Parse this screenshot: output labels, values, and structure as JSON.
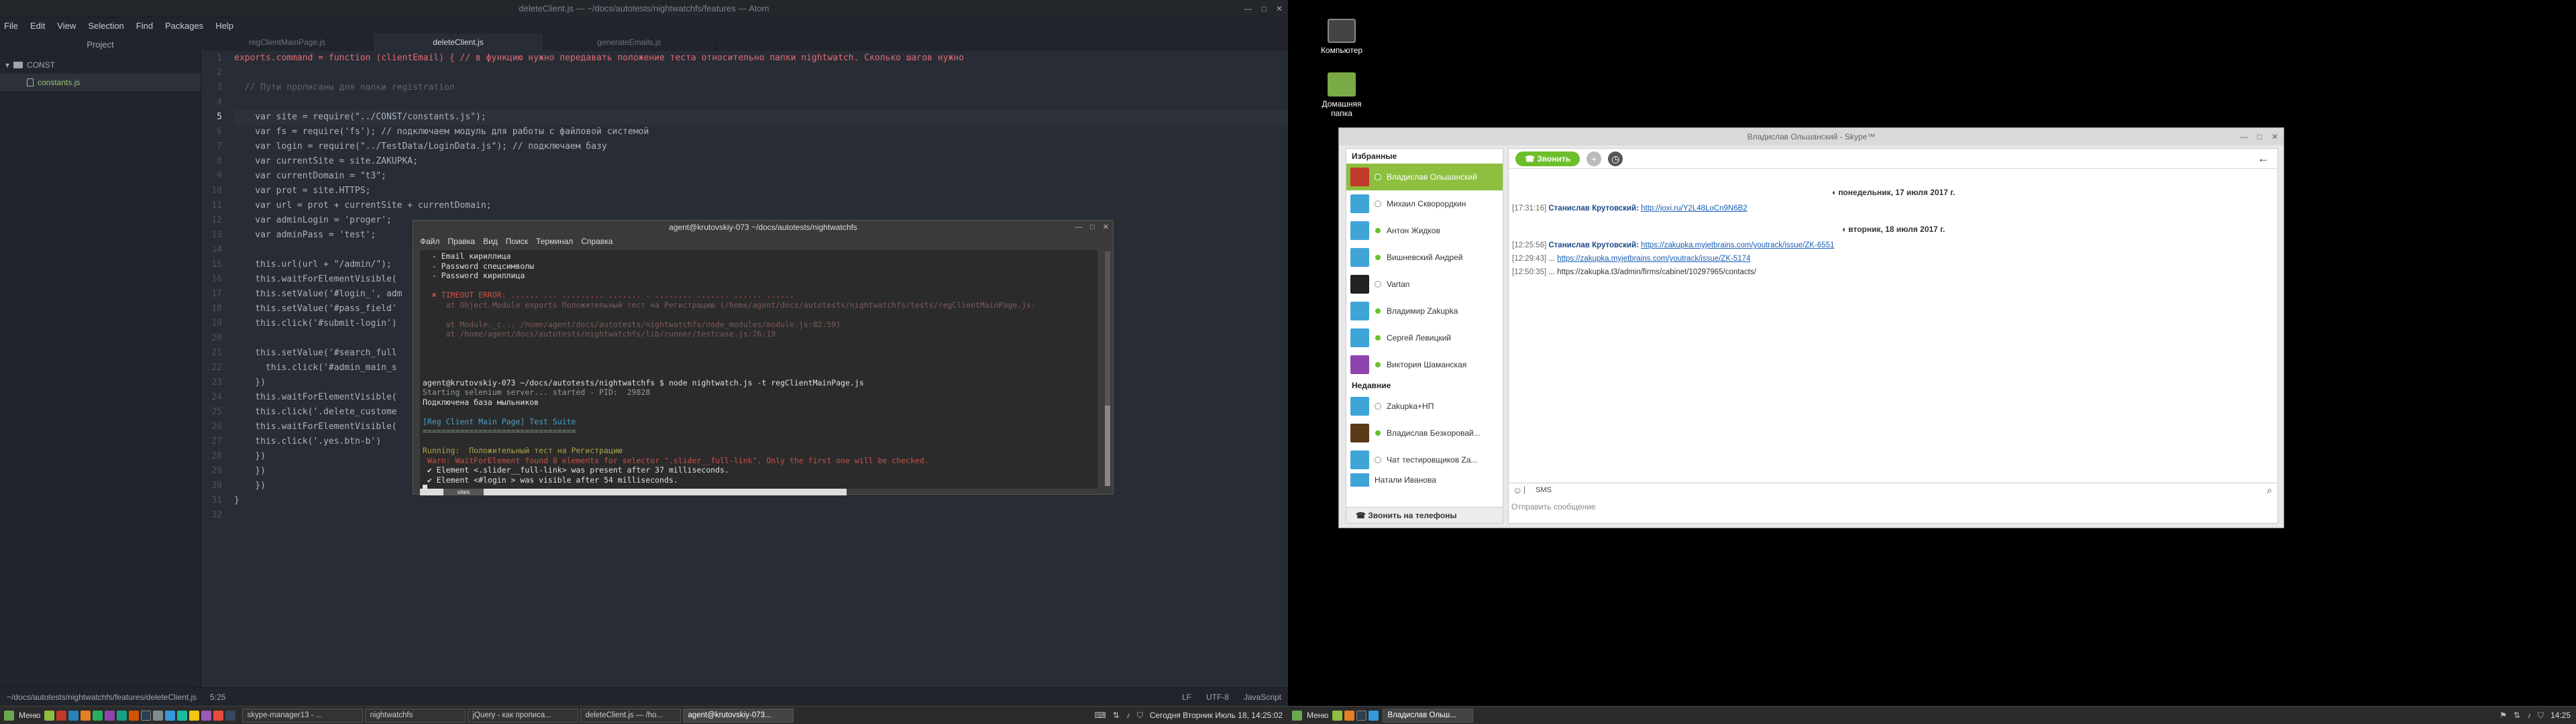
{
  "atom": {
    "title": "deleteClient.js — ~/docs/autotests/nightwatchfs/features — Atom",
    "menu": [
      "File",
      "Edit",
      "View",
      "Selection",
      "Find",
      "Packages",
      "Help"
    ],
    "tree_title": "Project",
    "tree": [
      {
        "label": "CONST",
        "type": "folder"
      },
      {
        "label": "constants.js",
        "type": "file"
      }
    ],
    "tabs": [
      "regClientMainPage.js",
      "deleteClient.js",
      "generateEmails.js"
    ],
    "status_path": "~/docs/autotests/nightwatchfs/features/deleteClient.js",
    "status_pos": "5:25",
    "status_eol": "LF",
    "status_enc": "UTF-8",
    "status_lang": "JavaScript",
    "line_numbers": [
      "1",
      "2",
      "3",
      "4",
      "5",
      "6",
      "7",
      "8",
      "9",
      "10",
      "11",
      "12",
      "13",
      "14",
      "15",
      "16",
      "17",
      "18",
      "19",
      "20",
      "21",
      "22",
      "23",
      "24",
      "25",
      "26",
      "27",
      "28",
      "29",
      "30",
      "31",
      "32"
    ],
    "code_lines": [
      "exports.command = function (clientEmail) { // в функцию нужно передавать положение теста относительно папки nightwatch. Сколько шагов нужно",
      "",
      "  // Пути прописаны для папки registration",
      "",
      "    var site = require(\"../CONST/constants.js\");",
      "    var fs = require('fs'); // подключаем модуль для работы с файловой системой",
      "    var login = require(\"../TestData/LoginData.js\"); // подключаем базу",
      "    var currentSite = site.ZAKUPKA;",
      "    var currentDomain = \"t3\";",
      "    var prot = site.HTTPS;",
      "    var url = prot + currentSite + currentDomain;",
      "    var adminLogin = 'proger';",
      "    var adminPass = 'test';",
      "",
      "    this.url(url + \"/admin/\");",
      "    this.waitForElementVisible(",
      "    this.setValue('#login_', adm",
      "    this.setValue('#pass_field'",
      "    this.click('#submit-login')",
      "",
      "    this.setValue('#search_full",
      "      this.click('#admin_main_s",
      "    })",
      "    this.waitForElementVisible(",
      "    this.click('.delete_custome",
      "    this.waitForElementVisible(",
      "    this.click('.yes.btn-b')",
      "    })",
      "    })",
      "    })",
      "}",
      ""
    ]
  },
  "terminal": {
    "title": "agent@krutovskiy-073 ~/docs/autotests/nightwatchfs",
    "menu": [
      "Файл",
      "Правка",
      "Вид",
      "Поиск",
      "Терминал",
      "Справка"
    ],
    "lines": [
      {
        "c": "",
        "t": "  - Email кириллица"
      },
      {
        "c": "",
        "t": "  - Password спецсимволы"
      },
      {
        "c": "",
        "t": "  - Password кириллица"
      },
      {
        "c": "",
        "t": ""
      },
      {
        "c": "red",
        "t": "  ✖ TIMEOUT ERROR: ...... ... ......... ....... . ........ ....... ...... ......"
      },
      {
        "c": "dim",
        "t": "     at Object.Module exports Положительный тест на Регистрацию (/home/agent/docs/autotests/nightwatchfs/tests/regClientMainPage.js:"
      },
      {
        "c": "dim",
        "t": ""
      },
      {
        "c": "dim",
        "t": "     at Module._c... /home/agent/docs/autotests/nightwatchfs/node_modules/module.js:82:59)"
      },
      {
        "c": "dim",
        "t": "     at /home/agent/docs/autotests/nightwatchfs/lib/runner/testcase.js:76:19"
      },
      {
        "c": "",
        "t": ""
      },
      {
        "c": "",
        "t": ""
      },
      {
        "c": "",
        "t": ""
      },
      {
        "c": "",
        "t": ""
      },
      {
        "c": "prompt",
        "t": "agent@krutovskiy-073 ~/docs/autotests/nightwatchfs $ node nightwatch.js -t regClientMainPage.js"
      },
      {
        "c": "dk",
        "t": "Starting selenium server... started - PID:  29828"
      },
      {
        "c": "",
        "t": "Подключена база мыльников"
      },
      {
        "c": "",
        "t": ""
      },
      {
        "c": "cy",
        "t": "[Reg Client Main Page] Test Suite"
      },
      {
        "c": "dk",
        "t": "================================="
      },
      {
        "c": "",
        "t": ""
      },
      {
        "c": "yl",
        "t": "Running:  Положительный тест на Регистрацию"
      },
      {
        "c": "red",
        "t": " Warn: WaitForElement found 8 elements for selector \".slider__full-link\". Only the first one will be checked."
      },
      {
        "c": "",
        "t": " ✔ Element <.slider__full-link> was present after 37 milliseconds."
      },
      {
        "c": "",
        "t": " ✔ Element <#login > was visible after 54 milliseconds."
      }
    ],
    "tab_label": "sites"
  },
  "taskbar_left": {
    "menu_label": "Меню",
    "tasks": [
      "skype-manager13 - ...",
      "nightwatchfs",
      "jQuery - как прописа...",
      "deleteClient.js — /ho...",
      "agent@krutovskiy-073..."
    ],
    "clock": "Сегодня Вторник Июль 18, 14:25:02"
  },
  "desktop": {
    "icons": [
      "Компьютер",
      "Домашняя папка"
    ]
  },
  "skype": {
    "title": "Владислав Ольшанский - Skype™",
    "favorites_label": "Избранные",
    "favorites": [
      "Владислав Ольшанский",
      "Михаил Скворордкин",
      "Антон Жидков",
      "Вишневский Андрей",
      "Vartan",
      "Владимир Zakupka",
      "Сергей Левицкий",
      "Виктория Шаманская"
    ],
    "recent_label": "Недавние",
    "recent": [
      "Zakupka+НП",
      "Владислав Безкоровай...",
      "Чат тестировщиков Za...",
      "Натали Иванова"
    ],
    "call_phones": "Звонить на телефоны",
    "call_button": "Звонить",
    "dates": [
      "понедельник, 17 июля 2017 г.",
      "вторник, 18 июля 2017 г."
    ],
    "messages": [
      {
        "time": "[17:31:16]",
        "name": "Станислав Крутовский:",
        "link": "http://joxi.ru/Y2L48LoCn9N6B2"
      },
      {
        "time": "[12:25:56]",
        "name": "Станислав Крутовский:",
        "link": "https://zakupka.myjetbrains.com/youtrack/issue/ZK-6551"
      },
      {
        "time": "[12:29:43]",
        "name": "...",
        "link": "https://zakupka.myjetbrains.com/youtrack/issue/ZK-5174"
      },
      {
        "time": "[12:50:35]",
        "name": "...",
        "link": "https://zakupka.t3/admin/firms/cabinet/10297965/contacts/"
      }
    ],
    "sms_label": "SMS",
    "input_placeholder": "Отправить сообщение"
  },
  "taskbar_right": {
    "menu_label": "Меню",
    "tasks": [
      "Владислав Ольш..."
    ],
    "clock": "14:25"
  }
}
